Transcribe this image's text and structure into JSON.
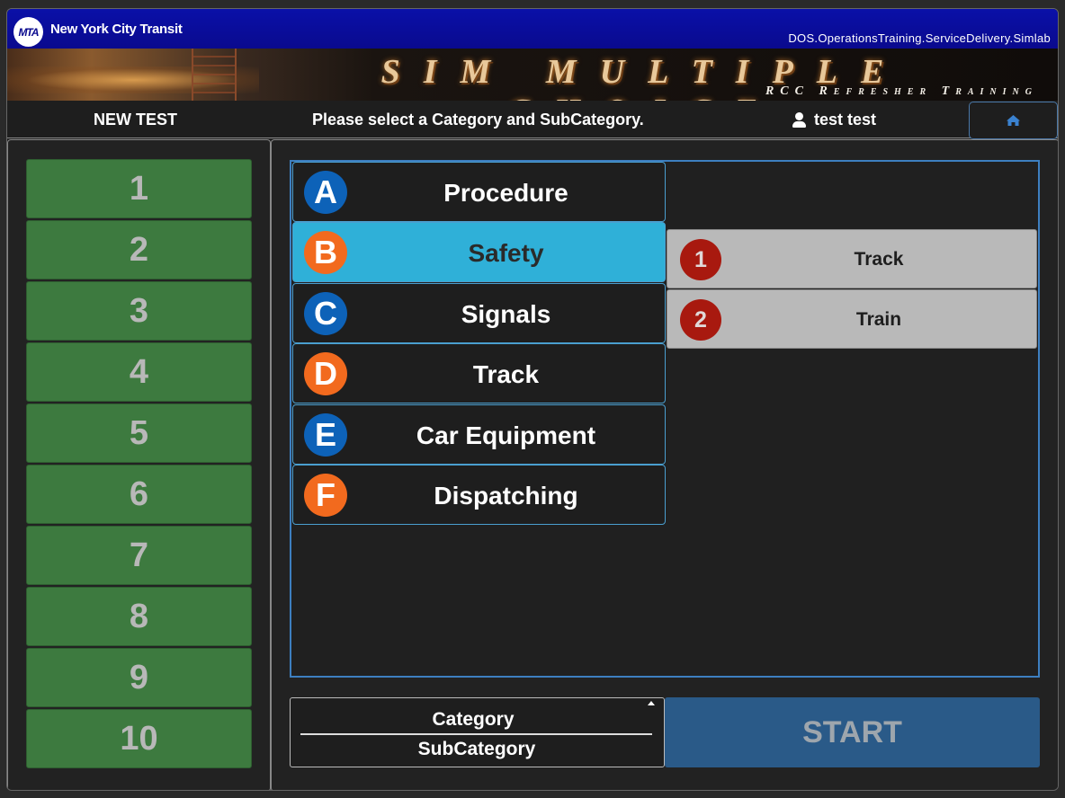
{
  "header": {
    "logo_text": "MTA",
    "org_name": "New York City Transit",
    "system_path": "DOS.OperationsTraining.ServiceDelivery.Simlab"
  },
  "banner": {
    "title": "SIM MULTIPLE CHOICE",
    "subtitle": "RCC Refresher Training"
  },
  "navbar": {
    "new_test_label": "NEW TEST",
    "instruction": "Please select a Category and SubCategory.",
    "user_name": "test test",
    "home_icon": "home-icon"
  },
  "test_numbers": [
    "1",
    "2",
    "3",
    "4",
    "5",
    "6",
    "7",
    "8",
    "9",
    "10"
  ],
  "categories": [
    {
      "letter": "A",
      "label": "Procedure",
      "badge_color": "#0d62b8"
    },
    {
      "letter": "B",
      "label": "Safety",
      "badge_color": "#f26a1e",
      "selected": true
    },
    {
      "letter": "C",
      "label": "Signals",
      "badge_color": "#0d62b8"
    },
    {
      "letter": "D",
      "label": "Track",
      "badge_color": "#f26a1e"
    },
    {
      "letter": "E",
      "label": "Car Equipment",
      "badge_color": "#0d62b8"
    },
    {
      "letter": "F",
      "label": "Dispatching",
      "badge_color": "#f26a1e"
    }
  ],
  "subcategories": [
    {
      "number": "1",
      "label": "Track"
    },
    {
      "number": "2",
      "label": "Train"
    }
  ],
  "summary": {
    "category_label": "Category",
    "subcategory_label": "SubCategory"
  },
  "start_label": "START",
  "colors": {
    "header_blue": "#0a0a8e",
    "number_green": "#3d7a3f",
    "selected_cyan": "#2fb0d8",
    "sub_badge_red": "#a8190f",
    "start_blue": "#2a5a88"
  }
}
